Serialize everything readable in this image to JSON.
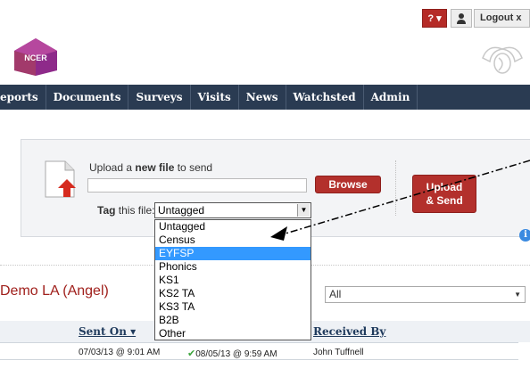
{
  "header": {
    "help_label": "? ▾",
    "logout_label": "Logout x",
    "logo_text": "NCER",
    "user_icon": "user-icon",
    "emblem_icon": "emblem-icon"
  },
  "nav": {
    "items": [
      {
        "label": "eports"
      },
      {
        "label": "Documents"
      },
      {
        "label": "Surveys"
      },
      {
        "label": "Visits"
      },
      {
        "label": "News"
      },
      {
        "label": "Watchsted"
      },
      {
        "label": "Admin"
      }
    ]
  },
  "upload": {
    "title_prefix": "Upload a ",
    "title_bold": "new file",
    "title_suffix": " to send",
    "file_value": "",
    "browse_label": "Browse",
    "send_label_line1": "Upload",
    "send_label_line2": "& Send",
    "tag_bold": "Tag",
    "tag_rest": " this file:",
    "tag_selected": "Untagged",
    "tag_options": [
      "Untagged",
      "Census",
      "EYFSP",
      "Phonics",
      "KS1",
      "KS2 TA",
      "KS3 TA",
      "B2B",
      "Other"
    ],
    "highlighted_option": "EYFSP"
  },
  "section": {
    "title": "Demo LA (Angel)",
    "filter_value": "All"
  },
  "table": {
    "headers": {
      "sent_on": "Sent On ▾",
      "received_by": "Received By"
    },
    "rows": [
      {
        "sent_on": "07/03/13 @ 9:01 AM",
        "received_on": "08/05/13 @ 9:59 AM",
        "received_by": "John Tuffnell"
      }
    ]
  },
  "colors": {
    "nav_bg": "#2a3b52",
    "accent_red": "#b3302c",
    "title_red": "#a0201c",
    "highlight_blue": "#3399ff"
  }
}
